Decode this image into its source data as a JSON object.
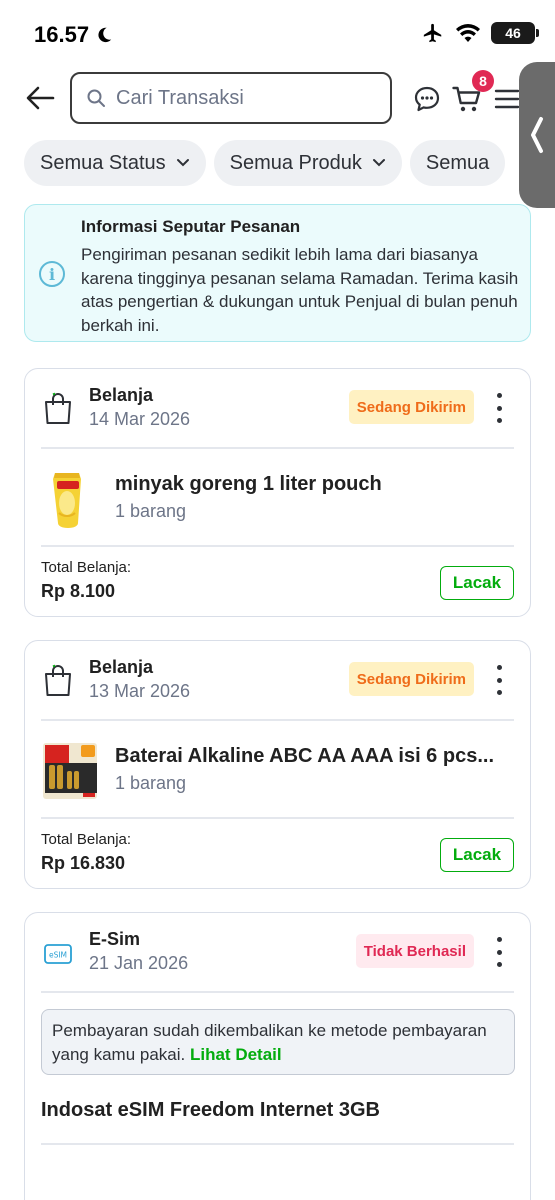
{
  "status_bar": {
    "time": "16.57",
    "battery": "46"
  },
  "header": {
    "search_placeholder": "Cari Transaksi",
    "cart_count": "8"
  },
  "filters": [
    {
      "label": "Semua Status"
    },
    {
      "label": "Semua Produk"
    },
    {
      "label": "Semua"
    }
  ],
  "info": {
    "title": "Informasi Seputar Pesanan",
    "text": "Pengiriman pesanan sedikit lebih lama dari biasanya karena tingginya pesanan selama Ramadan. Terima kasih atas pengertian & dukungan untuk Penjual di bulan penuh berkah ini."
  },
  "orders": [
    {
      "category": "Belanja",
      "date": "14 Mar 2026",
      "status": "Sedang Dikirim",
      "product_name": "minyak goreng 1 liter pouch",
      "qty": "1 barang",
      "total_label": "Total Belanja:",
      "total": "Rp 8.100",
      "action": "Lacak"
    },
    {
      "category": "Belanja",
      "date": "13 Mar 2026",
      "status": "Sedang Dikirim",
      "product_name": "Baterai Alkaline ABC AA AAA isi 6 pcs...",
      "qty": "1 barang",
      "total_label": "Total Belanja:",
      "total": "Rp 16.830",
      "action": "Lacak"
    },
    {
      "category": "E-Sim",
      "date": "21 Jan 2026",
      "status": "Tidak Berhasil",
      "refund_text": "Pembayaran sudah dikembalikan ke metode pembayaran yang kamu pakai.",
      "refund_link": "Lihat Detail",
      "product_name": "Indosat eSIM Freedom Internet 3GB"
    }
  ],
  "colors": {
    "accent_green": "#03ac0e",
    "badge_red": "#e02954",
    "shipping_text": "#ef6c1a",
    "shipping_bg": "#fff1c2",
    "info_bg": "#ebfbfc"
  },
  "icons": {
    "back": "arrow-left-icon",
    "search": "search-icon",
    "chat": "chat-icon",
    "cart": "cart-icon",
    "menu": "hamburger-menu-icon",
    "shopping_bag": "shopping-bag-icon",
    "esim": "esim-icon",
    "info": "info-icon",
    "kebab": "more-vertical-icon"
  }
}
